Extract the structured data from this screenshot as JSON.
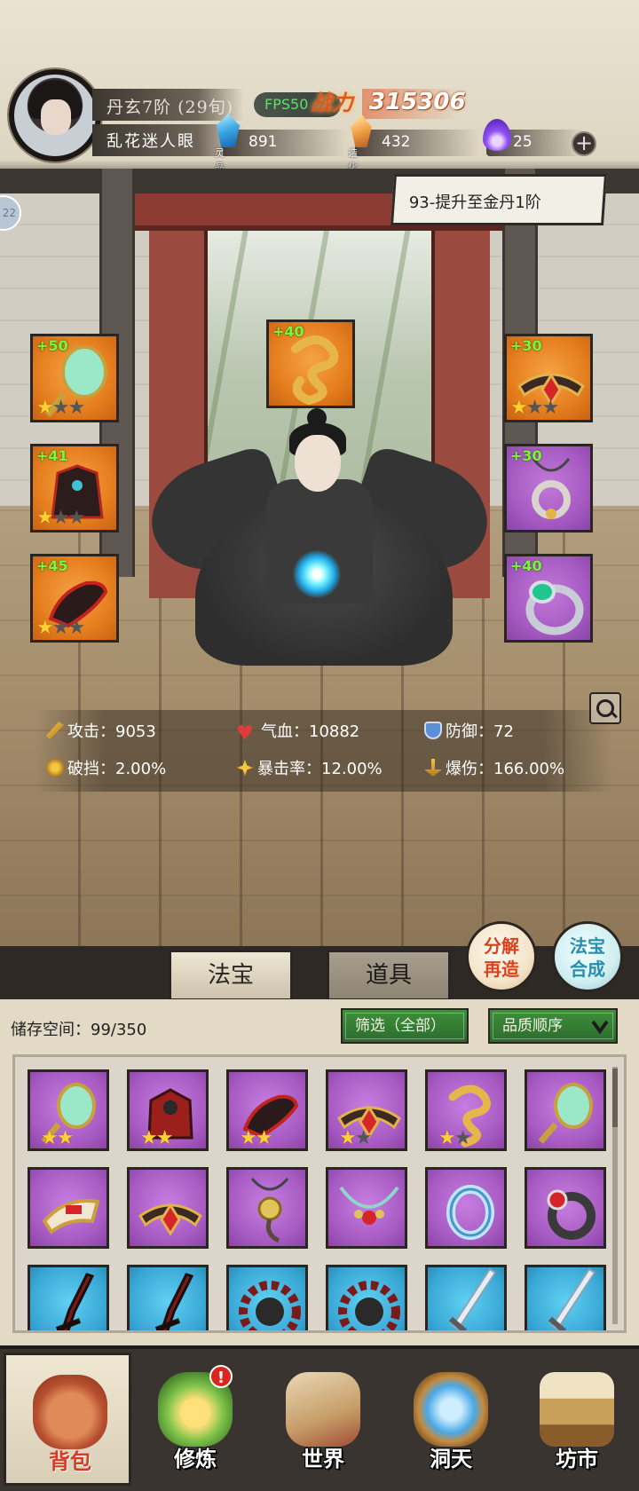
{
  "header": {
    "player_name": "丹玄7阶",
    "player_age": "(29旬)",
    "title": "乱花迷人眼",
    "fps": "FPS50",
    "power_label": "战力",
    "power_value": "315306",
    "resources": [
      {
        "name": "灵晶",
        "value": "891",
        "icon": "blue-crystal-icon"
      },
      {
        "name": "造化石",
        "value": "432",
        "icon": "orange-stone-icon"
      },
      {
        "name": "",
        "value": "25",
        "icon": "purple-flame-icon"
      }
    ],
    "add_label": "+"
  },
  "side_tab": {
    "label": "22"
  },
  "quest": {
    "label": "93-提升至金丹1阶"
  },
  "equipped": [
    {
      "bonus": "+50",
      "rarity": "orange",
      "stars_on": 1,
      "stars_total": 3,
      "icon": "jade-fan-icon"
    },
    {
      "bonus": "+40",
      "rarity": "orange",
      "stars_on": 0,
      "stars_total": 0,
      "icon": "golden-dragon-icon"
    },
    {
      "bonus": "+30",
      "rarity": "orange",
      "stars_on": 1,
      "stars_total": 3,
      "icon": "ruby-crown-icon"
    },
    {
      "bonus": "+41",
      "rarity": "orange",
      "stars_on": 1,
      "stars_total": 3,
      "icon": "dark-armor-icon"
    },
    {
      "bonus": "+30",
      "rarity": "purple",
      "stars_on": 0,
      "stars_total": 0,
      "icon": "pendant-icon"
    },
    {
      "bonus": "+45",
      "rarity": "orange",
      "stars_on": 1,
      "stars_total": 3,
      "icon": "red-boots-icon"
    },
    {
      "bonus": "+40",
      "rarity": "purple",
      "stars_on": 0,
      "stars_total": 0,
      "icon": "emerald-ring-icon"
    }
  ],
  "stats": {
    "attack": "攻击：9053",
    "hp": "气血：10882",
    "defense": "防御：72",
    "break": "破挡：2.00%",
    "crit_rate": "暴击率：12.00%",
    "crit_dmg": "爆伤：166.00%"
  },
  "tabs": {
    "treasure": "法宝",
    "items": "道具"
  },
  "actions": {
    "forge_line1": "分解",
    "forge_line2": "再造",
    "merge_line1": "法宝",
    "merge_line2": "合成"
  },
  "inventory": {
    "storage_label": "储存空间：",
    "storage_value": "99/350",
    "filter": "筛选（全部）",
    "sort": "品质顺序",
    "items": [
      {
        "rarity": "purple",
        "icon": "jade-fan-icon",
        "stars_on": 2,
        "stars_total": 2
      },
      {
        "rarity": "purple",
        "icon": "red-armor-icon",
        "stars_on": 2,
        "stars_total": 2
      },
      {
        "rarity": "purple",
        "icon": "red-boots-icon",
        "stars_on": 2,
        "stars_total": 2
      },
      {
        "rarity": "purple",
        "icon": "ruby-crown-icon",
        "stars_on": 1,
        "stars_total": 2
      },
      {
        "rarity": "purple",
        "icon": "golden-dragon-icon",
        "stars_on": 1,
        "stars_total": 2
      },
      {
        "rarity": "purple",
        "icon": "jade-fan-icon",
        "stars_on": 0,
        "stars_total": 0
      },
      {
        "rarity": "purple",
        "icon": "gold-bracer-icon",
        "stars_on": 0,
        "stars_total": 0
      },
      {
        "rarity": "purple",
        "icon": "ruby-crown-icon",
        "stars_on": 0,
        "stars_total": 0
      },
      {
        "rarity": "purple",
        "icon": "gold-pendant-icon",
        "stars_on": 0,
        "stars_total": 0
      },
      {
        "rarity": "purple",
        "icon": "jade-necklace-icon",
        "stars_on": 0,
        "stars_total": 0
      },
      {
        "rarity": "purple",
        "icon": "ice-ring-icon",
        "stars_on": 0,
        "stars_total": 0
      },
      {
        "rarity": "purple",
        "icon": "ruby-ring-icon",
        "stars_on": 0,
        "stars_total": 0
      },
      {
        "rarity": "blue",
        "icon": "red-blade-icon",
        "stars_on": 0,
        "stars_total": 0
      },
      {
        "rarity": "blue",
        "icon": "red-blade-icon",
        "stars_on": 0,
        "stars_total": 0
      },
      {
        "rarity": "blue",
        "icon": "red-wheel-icon",
        "stars_on": 0,
        "stars_total": 0
      },
      {
        "rarity": "blue",
        "icon": "red-wheel-icon",
        "stars_on": 0,
        "stars_total": 0
      },
      {
        "rarity": "blue",
        "icon": "silver-sword-icon",
        "stars_on": 0,
        "stars_total": 0
      },
      {
        "rarity": "blue",
        "icon": "silver-sword-icon",
        "stars_on": 0,
        "stars_total": 0
      }
    ]
  },
  "nav": [
    {
      "label": "背包",
      "icon": "backpack-icon",
      "active": true
    },
    {
      "label": "修炼",
      "icon": "lotus-icon",
      "active": false,
      "alert": "!"
    },
    {
      "label": "世界",
      "icon": "scroll-map-icon",
      "active": false
    },
    {
      "label": "洞天",
      "icon": "portal-icon",
      "active": false
    },
    {
      "label": "坊市",
      "icon": "market-stall-icon",
      "active": false
    }
  ],
  "colors": {
    "orange_slot": "#e57e1e",
    "purple_slot": "#a75bc3",
    "blue_slot": "#3aa8d6",
    "bonus_green": "#7cf53a",
    "star_gold": "#ffcf34",
    "power_orange": "#e0571d",
    "filter_green": "#2b6c2d"
  }
}
